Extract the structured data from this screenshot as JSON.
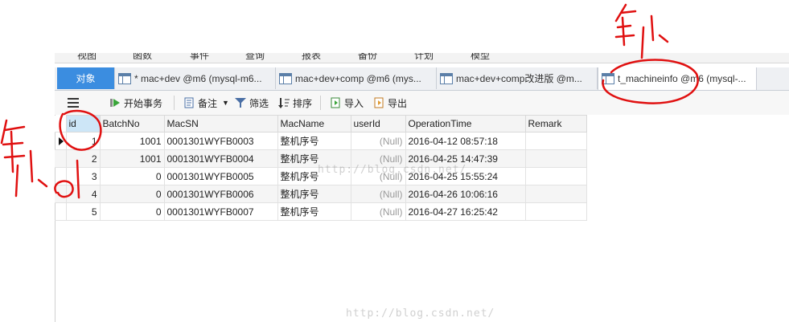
{
  "menubar": {
    "items": [
      "视图",
      "函数",
      "事件",
      "查询",
      "报表",
      "备份",
      "计划",
      "模型"
    ]
  },
  "tabs": {
    "objects": "对象",
    "items": [
      "* mac+dev @m6 (mysql-m6...",
      "mac+dev+comp @m6 (mys...",
      "mac+dev+comp改进版 @m...",
      "t_machineinfo @m6 (mysql-..."
    ]
  },
  "toolbar": {
    "menu_icon": "hamburger-icon",
    "begin_transaction": "开始事务",
    "memo": "备注",
    "filter": "筛选",
    "sort": "排序",
    "import": "导入",
    "export": "导出"
  },
  "table": {
    "columns": [
      "id",
      "BatchNo",
      "MacSN",
      "MacName",
      "userId",
      "OperationTime",
      "Remark"
    ],
    "rows": [
      [
        "1",
        "1001",
        "0001301WYFB0003",
        "整机序号",
        "(Null)",
        "2016-04-12 08:57:18",
        ""
      ],
      [
        "2",
        "1001",
        "0001301WYFB0004",
        "整机序号",
        "(Null)",
        "2016-04-25 14:47:39",
        ""
      ],
      [
        "3",
        "0",
        "0001301WYFB0005",
        "整机序号",
        "(Null)",
        "2016-04-25 15:55:24",
        ""
      ],
      [
        "4",
        "0",
        "0001301WYFB0006",
        "整机序号",
        "(Null)",
        "2016-04-26 10:06:16",
        ""
      ],
      [
        "5",
        "0",
        "0001301WYFB0007",
        "整机序号",
        "(Null)",
        "2016-04-27 16:25:42",
        ""
      ]
    ]
  },
  "watermark": "http://blog.csdn.net/",
  "annotation_color": "#e01010",
  "accent_color": "#3b8de0"
}
